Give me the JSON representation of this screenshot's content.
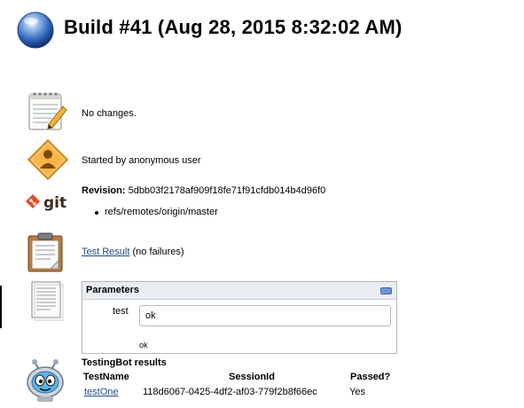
{
  "header": {
    "title": "Build #41 (Aug 28, 2015 8:32:02 AM)"
  },
  "changes": {
    "text": "No changes."
  },
  "cause": {
    "text": "Started by anonymous user"
  },
  "revision": {
    "label": "Revision:",
    "hash": "5dbb03f2178af909f18fe71f91cfdb014b4d96f0",
    "branch": "refs/remotes/origin/master",
    "icon_text": "git"
  },
  "test_result": {
    "link": "Test Result",
    "suffix": "(no failures)"
  },
  "parameters": {
    "title": "Parameters",
    "name": "test",
    "value": "ok",
    "description": "ok"
  },
  "testingbot": {
    "title": "TestingBot results",
    "headers": [
      "TestName",
      "SessionId",
      "Passed?"
    ],
    "rows": [
      {
        "name": "testOne",
        "session": "118d6067-0425-4df2-af03-779f2b8f66ec",
        "passed": "Yes"
      }
    ]
  },
  "colors": {
    "link": "#204a87",
    "ball": "#3a6fc4",
    "git": "#e04e2a",
    "panel_header": "#eaeef3"
  },
  "icons": [
    "blue-ball-icon",
    "notepad-icon",
    "user-diamond-icon",
    "git-icon",
    "clipboard-icon",
    "document-icon",
    "testingbot-robot-icon"
  ]
}
